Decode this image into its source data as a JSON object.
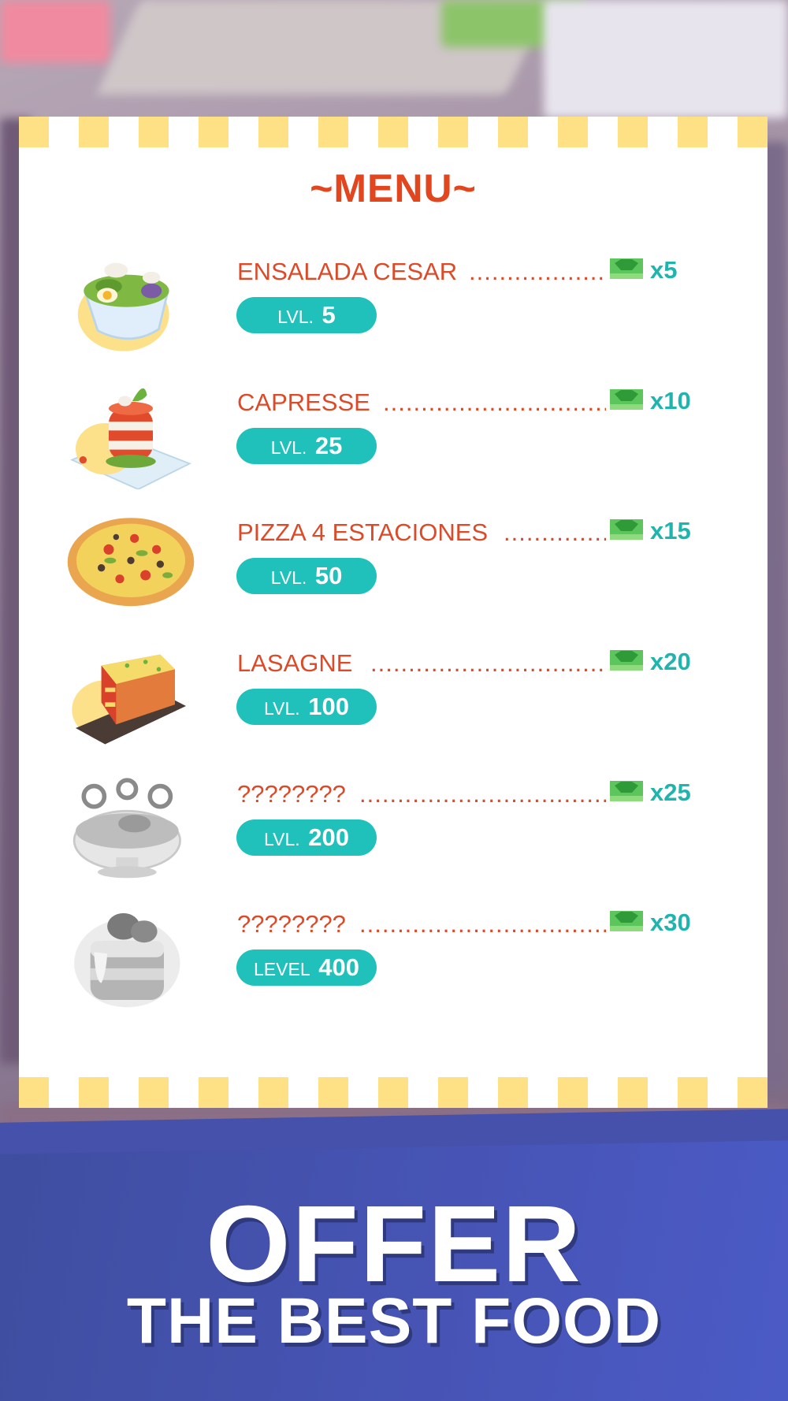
{
  "colors": {
    "title_red": "#e2461f",
    "item_red": "#dc4a28",
    "teal": "#20c0bb",
    "stripe_yellow": "#fde184",
    "banner_blue": "#4754b5",
    "cash_green": "#5cc65c"
  },
  "menu": {
    "title": "~MENU~",
    "items": [
      {
        "name": "ENSALADA CESAR",
        "dots": "......................",
        "multiplier": "x5",
        "level_prefix": "LVL.",
        "level": "5",
        "food_icon": "caesar-salad-icon",
        "locked": false
      },
      {
        "name": "CAPRESSE",
        "dots": "...................................",
        "multiplier": "x10",
        "level_prefix": "LVL.",
        "level": "25",
        "food_icon": "caprese-tower-icon",
        "locked": false
      },
      {
        "name": "PIZZA 4 ESTACIONES",
        "dots": ".................",
        "multiplier": "x15",
        "level_prefix": "LVL.",
        "level": "50",
        "food_icon": "pizza-icon",
        "locked": false
      },
      {
        "name": "LASAGNE",
        "dots": "......................................",
        "multiplier": "x20",
        "level_prefix": "LVL.",
        "level": "100",
        "food_icon": "lasagne-icon",
        "locked": false
      },
      {
        "name": "????????",
        "dots": " ......................................",
        "multiplier": "x25",
        "level_prefix": "LVL.",
        "level": "200",
        "food_icon": "locked-bowl-icon",
        "locked": true
      },
      {
        "name": "????????",
        "dots": " ......................................",
        "multiplier": "x30",
        "level_prefix": "LEVEL",
        "level": "400",
        "food_icon": "locked-cake-icon",
        "locked": true
      }
    ],
    "cash_icon": "cash-bill-icon"
  },
  "banner": {
    "line1": "OFFER",
    "line2": "THE BEST FOOD"
  }
}
